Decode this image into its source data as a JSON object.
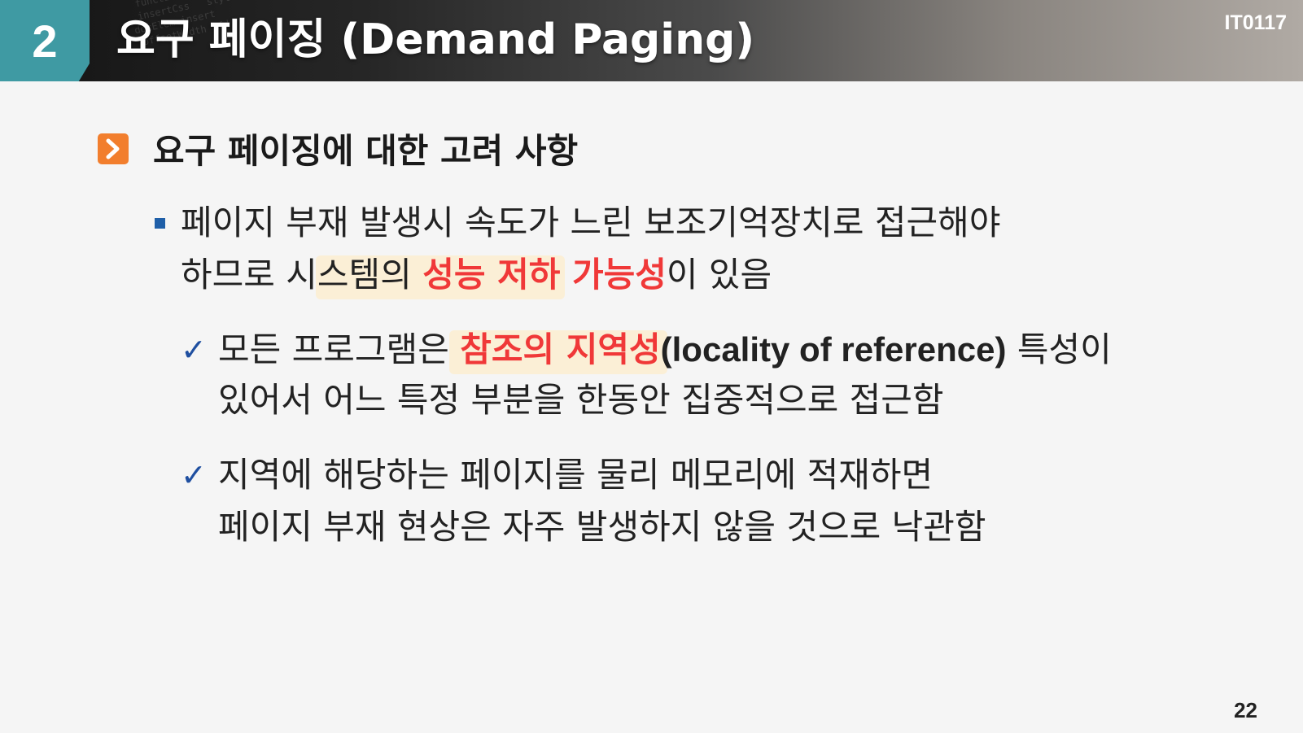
{
  "header": {
    "section_number": "2",
    "title": "요구 페이징 (Demand Paging)",
    "course_code": "IT0117"
  },
  "section": {
    "heading": "요구 페이징에 대한 고려 사항"
  },
  "bullet1": {
    "line1": "페이지 부재 발생시 속도가 느린 보조기억장치로 접근해야",
    "line2_prefix": "하므로 시스템의 ",
    "line2_highlight": "성능 저하 가능성",
    "line2_suffix": "이 있음"
  },
  "check1": {
    "mark": "✓",
    "line1_prefix": "모든 프로그램은 ",
    "line1_highlight": "참조의 지역성",
    "line1_latin": "(locality of reference)",
    "line1_suffix": " 특성이",
    "line2": "있어서 어느 특정 부분을 한동안 집중적으로 접근함"
  },
  "check2": {
    "mark": "✓",
    "line1": "지역에 해당하는 페이지를 물리 메모리에 적재하면",
    "line2": "페이지 부재 현상은 자주 발생하지 않을 것으로 낙관함"
  },
  "footer": {
    "page_number": "22"
  },
  "colors": {
    "accent_teal": "#3f9aa3",
    "accent_orange": "#f27e2d",
    "highlight_red": "#f03838",
    "bullet_blue": "#1f5fa8"
  }
}
